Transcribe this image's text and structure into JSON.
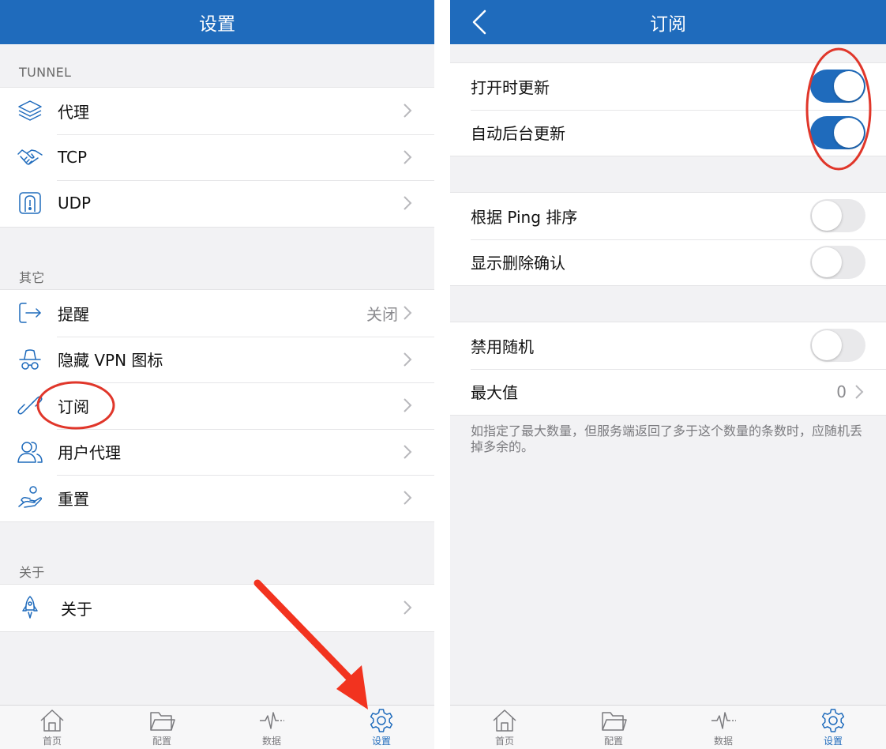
{
  "left": {
    "title": "设置",
    "sections": {
      "tunnel": {
        "header": "TUNNEL",
        "items": [
          {
            "label": "代理"
          },
          {
            "label": "TCP"
          },
          {
            "label": "UDP"
          }
        ]
      },
      "other": {
        "header": "其它",
        "items": [
          {
            "label": "提醒",
            "value": "关闭"
          },
          {
            "label": "隐藏 VPN 图标"
          },
          {
            "label": "订阅"
          },
          {
            "label": "用户代理"
          },
          {
            "label": "重置"
          }
        ]
      },
      "about": {
        "header": "关于",
        "items": [
          {
            "label": "关于"
          }
        ]
      }
    },
    "tabs": [
      {
        "label": "首页",
        "icon": "home-icon",
        "active": false
      },
      {
        "label": "配置",
        "icon": "folder-icon",
        "active": false
      },
      {
        "label": "数据",
        "icon": "pulse-icon",
        "active": false
      },
      {
        "label": "设置",
        "icon": "gear-icon",
        "active": true
      }
    ]
  },
  "right": {
    "title": "订阅",
    "groups": [
      [
        {
          "label": "打开时更新",
          "toggle": true
        },
        {
          "label": "自动后台更新",
          "toggle": true
        }
      ],
      [
        {
          "label": "根据 Ping 排序",
          "toggle": false
        },
        {
          "label": "显示删除确认",
          "toggle": false
        }
      ],
      [
        {
          "label": "禁用随机",
          "toggle": false
        },
        {
          "label": "最大值",
          "value": "0"
        }
      ]
    ],
    "footnote": "如指定了最大数量，但服务端返回了多于这个数量的条数时，应随机丢掉多余的。",
    "tabs": [
      {
        "label": "首页",
        "icon": "home-icon",
        "active": false
      },
      {
        "label": "配置",
        "icon": "folder-icon",
        "active": false
      },
      {
        "label": "数据",
        "icon": "pulse-icon",
        "active": false
      },
      {
        "label": "设置",
        "icon": "gear-icon",
        "active": true
      }
    ]
  },
  "colors": {
    "primary": "#1f6bbc",
    "annotation": "#e0362a",
    "arrow": "#f2331f",
    "toggle_off": "#e9e9eb",
    "background": "#f2f2f4"
  }
}
